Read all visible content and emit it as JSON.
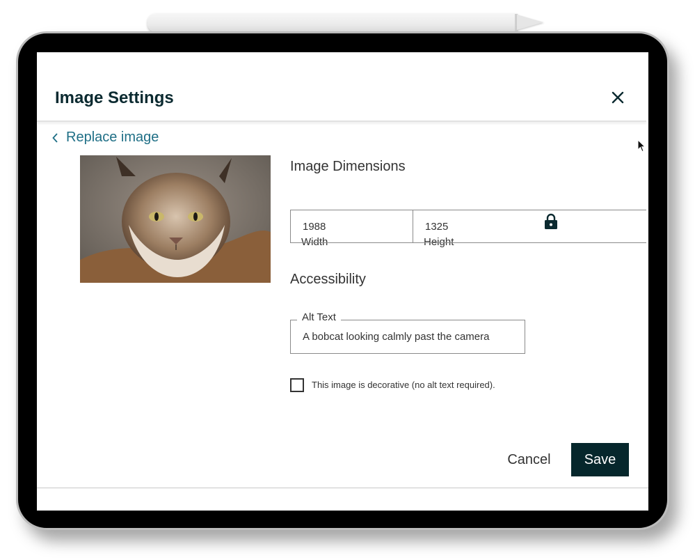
{
  "dialog": {
    "title": "Image Settings",
    "close_icon": "close-icon",
    "replace_label": "Replace image"
  },
  "dimensions": {
    "heading": "Image Dimensions",
    "width_value": "1988",
    "width_label": "Width",
    "height_value": "1325",
    "height_label": "Height",
    "lock_icon": "lock-icon"
  },
  "accessibility": {
    "heading": "Accessibility",
    "alt_label": "Alt Text",
    "alt_value": "A bobcat looking calmly past the camera",
    "decorative_label": "This image is decorative (no alt text required).",
    "decorative_checked": false
  },
  "actions": {
    "cancel_label": "Cancel",
    "save_label": "Save"
  },
  "colors": {
    "title": "#0b2a30",
    "link": "#1f6f86",
    "primary_button": "#06272c"
  }
}
